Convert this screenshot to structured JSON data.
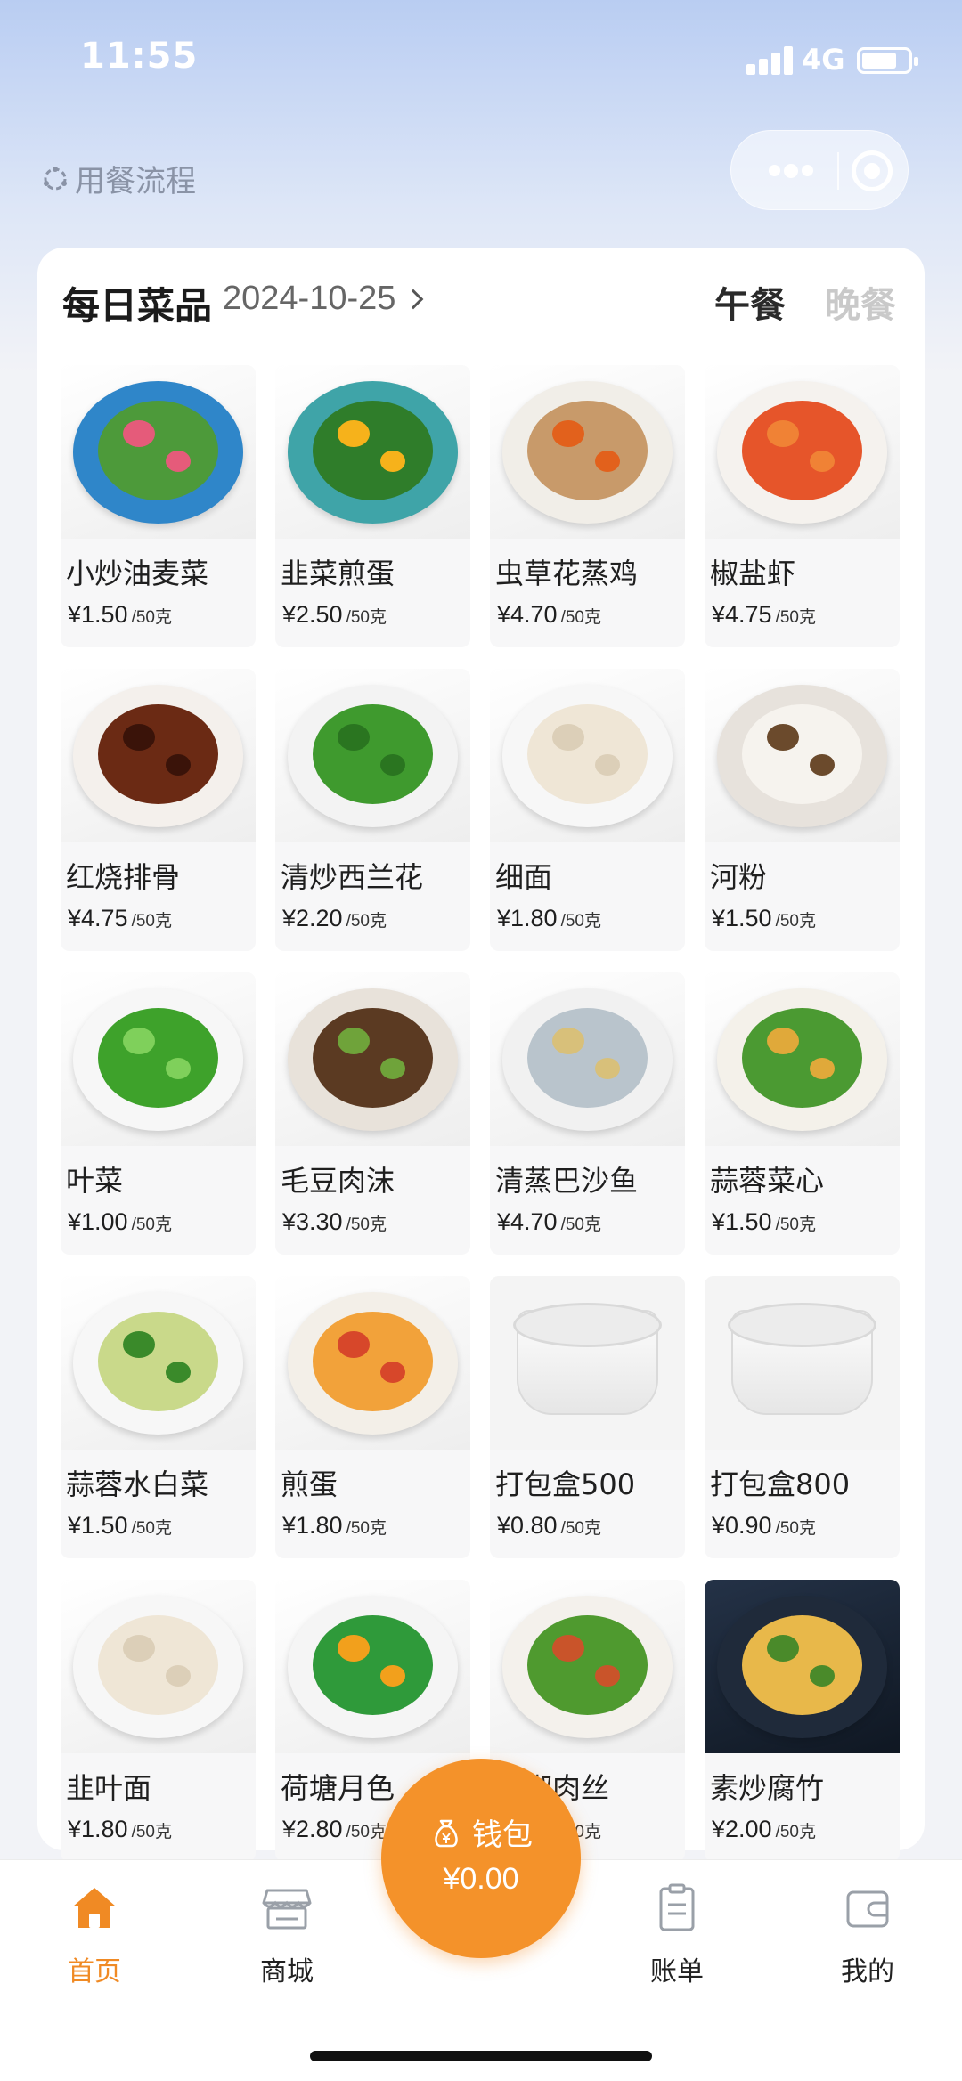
{
  "status_bar": {
    "time": "11:55",
    "network": "4G"
  },
  "header": {
    "process_label": "用餐流程"
  },
  "menu": {
    "title": "每日菜品",
    "date": "2024-10-25",
    "meal_tabs": [
      {
        "label": "午餐",
        "active": true
      },
      {
        "label": "晚餐",
        "active": false
      }
    ],
    "dishes": [
      {
        "name": "小炒油麦菜",
        "price": "¥1.50",
        "unit": "/50克",
        "plate": "#2f86c9",
        "food": "#4d9a3a",
        "accent": "#e55b7a"
      },
      {
        "name": "韭菜煎蛋",
        "price": "¥2.50",
        "unit": "/50克",
        "plate": "#3fa4a8",
        "food": "#2f7d2a",
        "accent": "#f6b21b"
      },
      {
        "name": "虫草花蒸鸡",
        "price": "¥4.70",
        "unit": "/50克",
        "plate": "#f1eee8",
        "food": "#c89a6a",
        "accent": "#e2611c"
      },
      {
        "name": "椒盐虾",
        "price": "¥4.75",
        "unit": "/50克",
        "plate": "#f5f2ee",
        "food": "#e6552a",
        "accent": "#f08235"
      },
      {
        "name": "红烧排骨",
        "price": "¥4.75",
        "unit": "/50克",
        "plate": "#f4f0ec",
        "food": "#6b2a14",
        "accent": "#3a1309"
      },
      {
        "name": "清炒西兰花",
        "price": "¥2.20",
        "unit": "/50克",
        "plate": "#f3f3f3",
        "food": "#3f9a2e",
        "accent": "#2a7520"
      },
      {
        "name": "细面",
        "price": "¥1.80",
        "unit": "/50克",
        "plate": "#f7f7f7",
        "food": "#efe6d6",
        "accent": "#dccfb8"
      },
      {
        "name": "河粉",
        "price": "¥1.50",
        "unit": "/50克",
        "plate": "#e7e2dc",
        "food": "#f6f3ee",
        "accent": "#6b4a2c"
      },
      {
        "name": "叶菜",
        "price": "¥1.00",
        "unit": "/50克",
        "plate": "#f7f7f7",
        "food": "#3ea22b",
        "accent": "#7fd05b"
      },
      {
        "name": "毛豆肉沫",
        "price": "¥3.30",
        "unit": "/50克",
        "plate": "#e8e2da",
        "food": "#5b3a22",
        "accent": "#6fa33a"
      },
      {
        "name": "清蒸巴沙鱼",
        "price": "¥4.70",
        "unit": "/50克",
        "plate": "#f1f1f1",
        "food": "#b9c4cc",
        "accent": "#d8c07a"
      },
      {
        "name": "蒜蓉菜心",
        "price": "¥1.50",
        "unit": "/50克",
        "plate": "#f4f1ea",
        "food": "#4b9a32",
        "accent": "#e0a93a"
      },
      {
        "name": "蒜蓉水白菜",
        "price": "¥1.50",
        "unit": "/50克",
        "plate": "#f7f7f7",
        "food": "#c9d98a",
        "accent": "#3a8a2a"
      },
      {
        "name": "煎蛋",
        "price": "¥1.80",
        "unit": "/50克",
        "plate": "#f3efe8",
        "food": "#f2a23a",
        "accent": "#d7472a"
      },
      {
        "name": "打包盒500",
        "price": "¥0.80",
        "unit": "/50克",
        "plate": "#efefef",
        "food": "#f7f7f7",
        "accent": "#dcdcdc"
      },
      {
        "name": "打包盒800",
        "price": "¥0.90",
        "unit": "/50克",
        "plate": "#efefef",
        "food": "#f7f7f7",
        "accent": "#dcdcdc"
      },
      {
        "name": "韭叶面",
        "price": "¥1.80",
        "unit": "/50克",
        "plate": "#f7f7f7",
        "food": "#efe6d6",
        "accent": "#dccfb8"
      },
      {
        "name": "荷塘月色",
        "price": "¥2.80",
        "unit": "/50克",
        "plate": "#f5f5f5",
        "food": "#2f9a3a",
        "accent": "#f2a01c"
      },
      {
        "name": "青椒肉丝",
        "price": "¥2.20",
        "unit": "/50克",
        "plate": "#f4f1ec",
        "food": "#4f9a2f",
        "accent": "#c9542a"
      },
      {
        "name": "素炒腐竹",
        "price": "¥2.00",
        "unit": "/50克",
        "plate": "#1f2a3a",
        "food": "#e8b84a",
        "accent": "#4a8a2a"
      }
    ]
  },
  "wallet": {
    "label": "钱包",
    "balance": "¥0.00"
  },
  "tabbar": {
    "items": [
      {
        "label": "首页",
        "icon": "home-icon",
        "active": true
      },
      {
        "label": "商城",
        "icon": "store-icon",
        "active": false
      },
      {
        "label": "账单",
        "icon": "bill-icon",
        "active": false
      },
      {
        "label": "我的",
        "icon": "wallet-card-icon",
        "active": false
      }
    ]
  },
  "colors": {
    "accent": "#f08a24",
    "wallet": "#f4922a"
  }
}
